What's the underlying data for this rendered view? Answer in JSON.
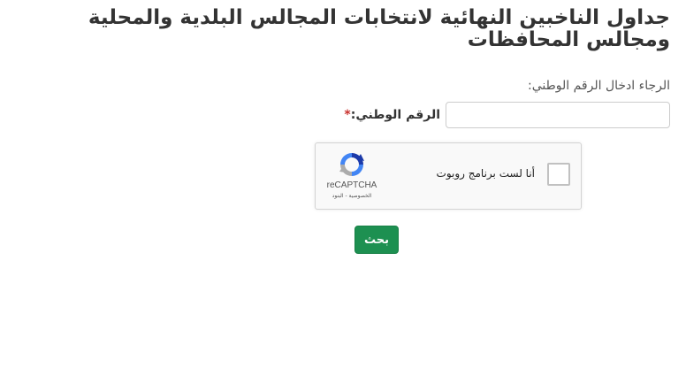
{
  "page": {
    "title": "جداول الناخبين النهائية لانتخابات المجالس البلدية والمحلية ومجالس المحافظات"
  },
  "form": {
    "instruction": "الرجاء ادخال الرقم الوطني:",
    "national_id_label": "الرقم الوطني:",
    "required_mark": "*",
    "national_id_value": "",
    "national_id_placeholder": ""
  },
  "captcha": {
    "checkbox_text": "أنا لست برنامج روبوت",
    "brand": "reCAPTCHA",
    "links": "الخصوصية - البنود",
    "icon": "recaptcha-icon",
    "checked": false
  },
  "actions": {
    "search_label": "بحث"
  },
  "colors": {
    "primary_button": "#1d9051",
    "required": "#c9302c",
    "text": "#333333"
  }
}
